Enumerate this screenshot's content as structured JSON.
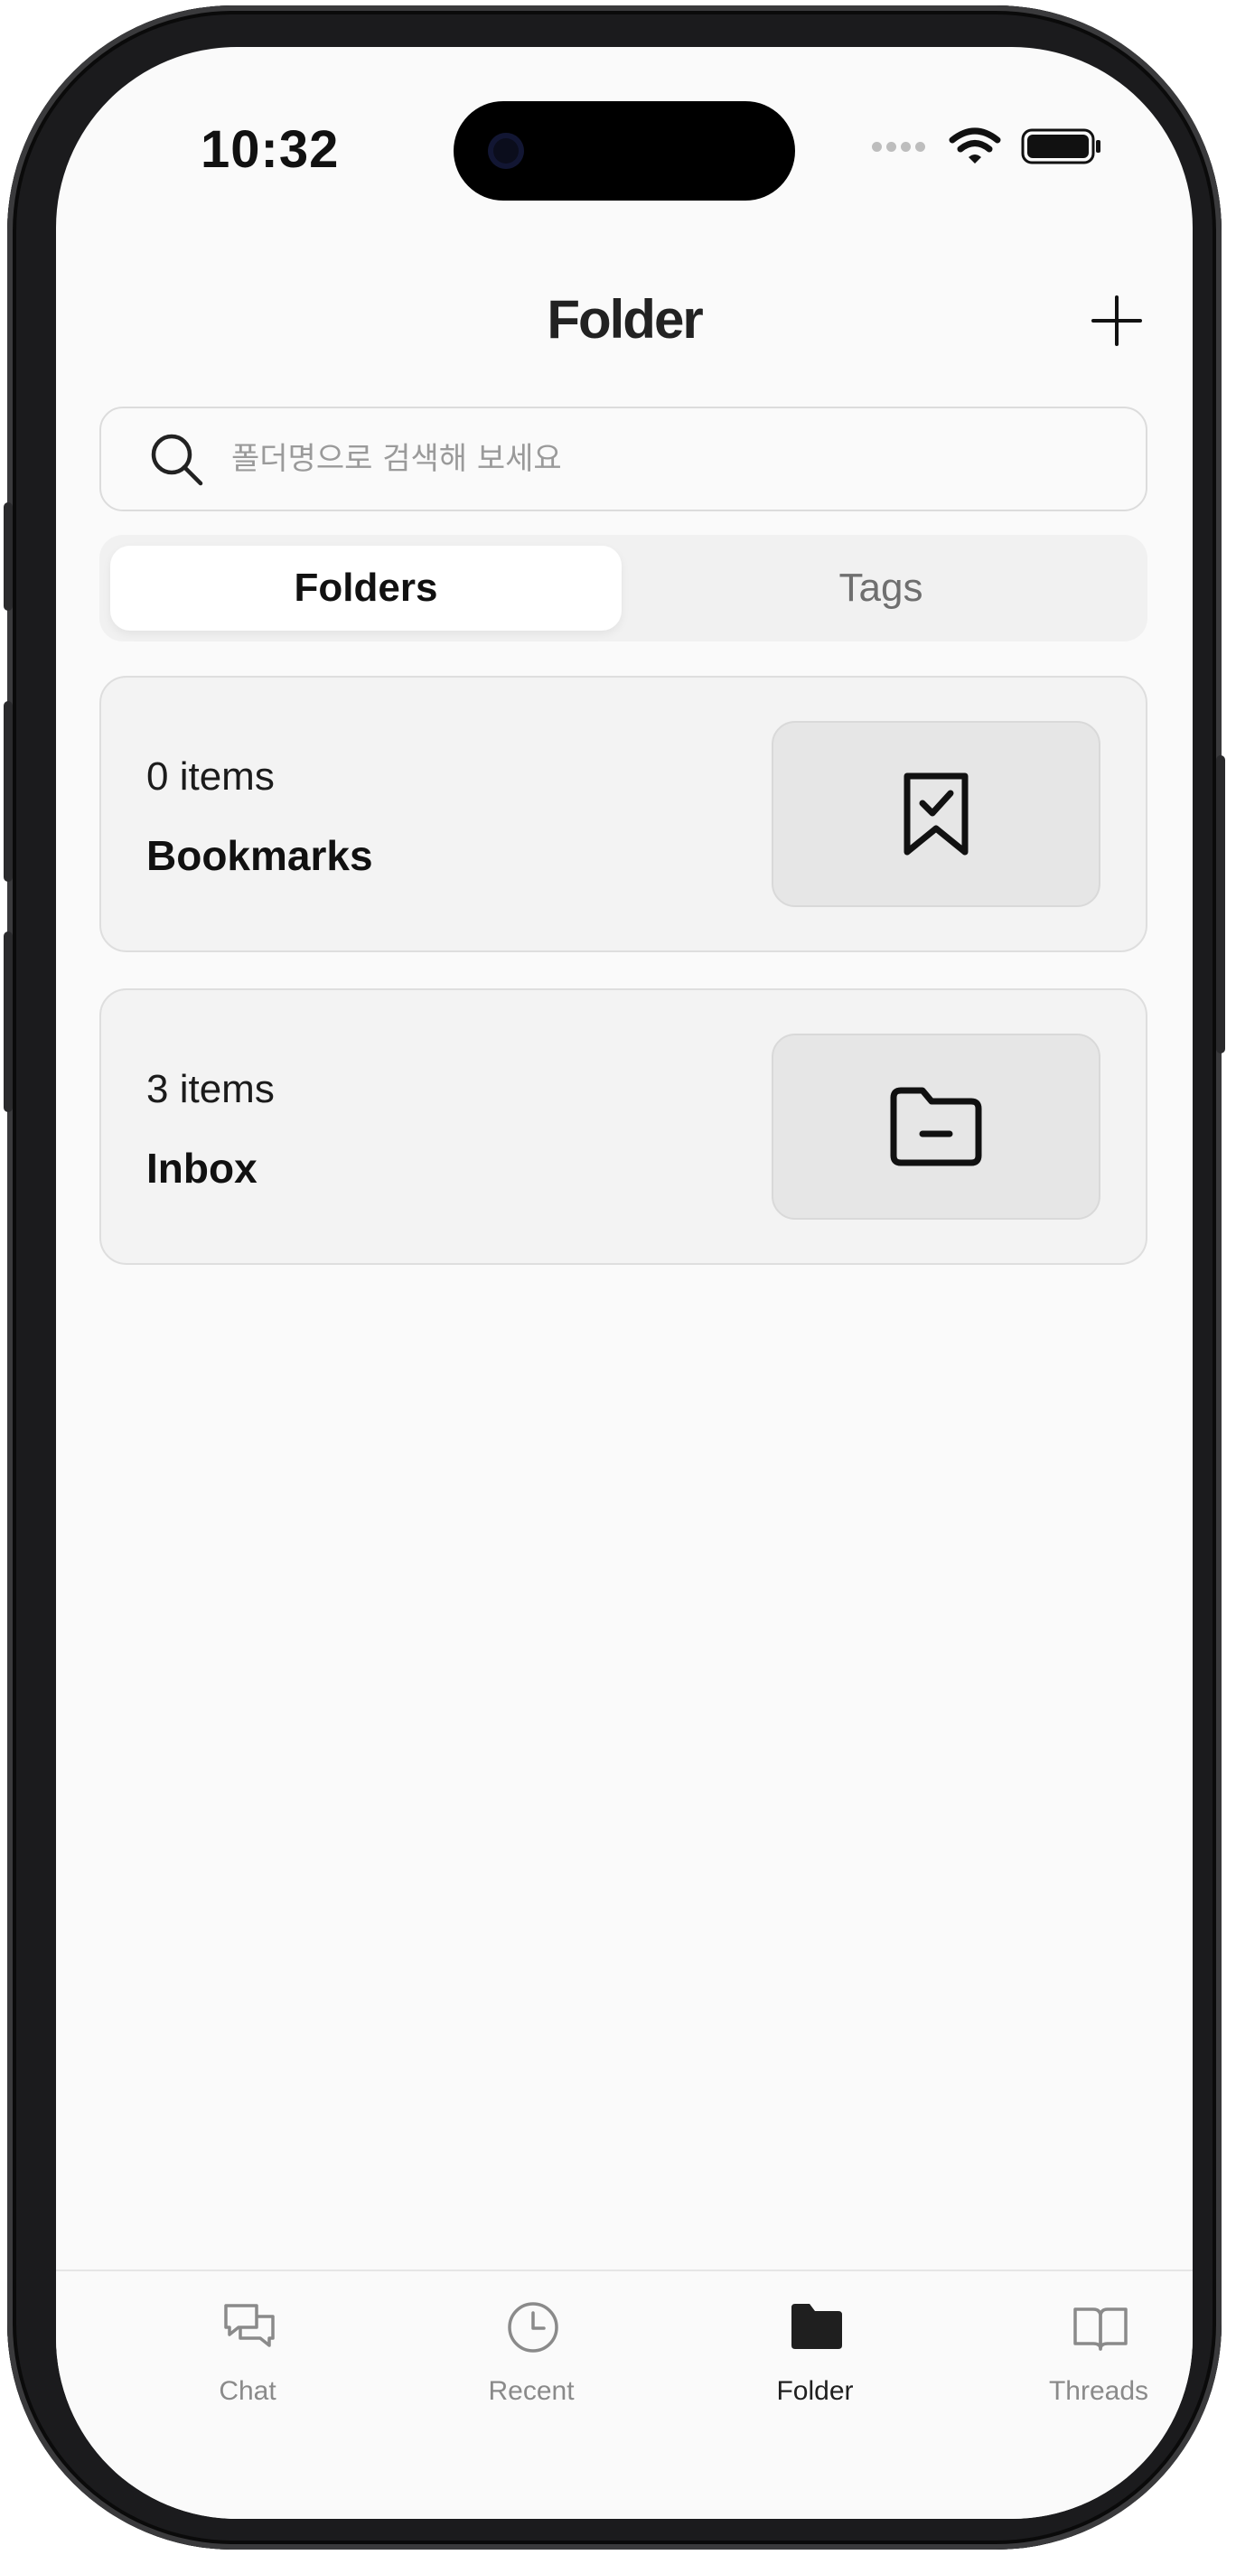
{
  "status_bar": {
    "time": "10:32"
  },
  "header": {
    "title": "Folder",
    "add_icon": "plus-icon"
  },
  "search": {
    "placeholder": "폴더명으로 검색해 보세요",
    "value": ""
  },
  "segment": {
    "tabs": [
      {
        "label": "Folders",
        "active": true
      },
      {
        "label": "Tags",
        "active": false
      }
    ]
  },
  "folders": [
    {
      "count": "0 items",
      "name": "Bookmarks",
      "icon": "bookmark-check-icon"
    },
    {
      "count": "3 items",
      "name": "Inbox",
      "icon": "folder-minus-icon"
    }
  ],
  "tabbar": {
    "items": [
      {
        "label": "Chat",
        "icon": "chat-icon",
        "active": false
      },
      {
        "label": "Recent",
        "icon": "clock-icon",
        "active": false
      },
      {
        "label": "Folder",
        "icon": "folder-icon",
        "active": true
      },
      {
        "label": "Threads",
        "icon": "book-open-icon",
        "active": false
      }
    ]
  },
  "colors": {
    "background": "#fafafa",
    "card": "#f3f3f3",
    "thumb": "#e6e6e6",
    "inactive_text": "#8a8a8a",
    "active_text": "#111111"
  }
}
